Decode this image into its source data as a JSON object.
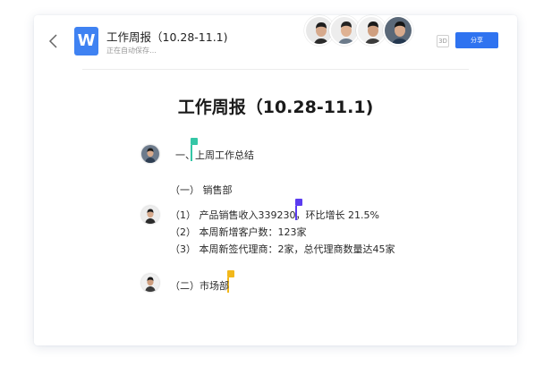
{
  "header": {
    "app_logo": "W",
    "doc_title": "工作周报（10.28-11.1)",
    "save_status": "正在自动保存…",
    "view_toggle": "3D",
    "share_label": "分享"
  },
  "document": {
    "heading": "工作周报（10.28-11.1)",
    "section1_title": "一、上周工作总结",
    "sub1_title": "（一） 销售部",
    "items": [
      "（1） 产品销售收入339230，环比增长 21.5%",
      "（2） 本周新增客户数：123家",
      "（3） 本周新签代理商：2家，总代理商数量达45家"
    ],
    "sub2_title": "（二）市场部"
  },
  "colors": {
    "accent_blue": "#2f73f0",
    "logo_blue": "#3f82f2",
    "cursor_teal": "#34c6a6",
    "cursor_purple": "#5b3cf0",
    "cursor_yellow": "#f2b81b"
  },
  "icons": {
    "back": "chevron-left-icon",
    "view_toggle": "3d-view-icon"
  }
}
